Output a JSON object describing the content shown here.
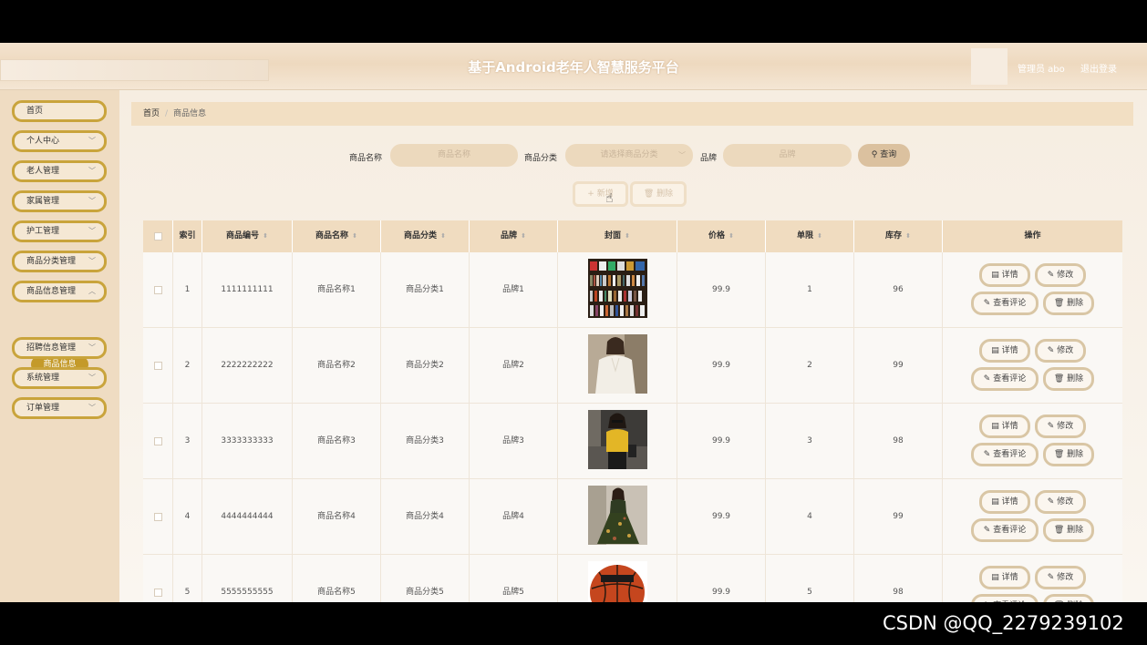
{
  "header": {
    "title": "基于Android老年人智慧服务平台",
    "user": "管理员 abo",
    "logout": "退出登录"
  },
  "sidebar": {
    "items": [
      {
        "label": "首页",
        "chevron": false
      },
      {
        "label": "个人中心",
        "chevron": true
      },
      {
        "label": "老人管理",
        "chevron": true
      },
      {
        "label": "家属管理",
        "chevron": true
      },
      {
        "label": "护工管理",
        "chevron": true
      },
      {
        "label": "商品分类管理",
        "chevron": true
      },
      {
        "label": "商品信息管理",
        "chevron": true
      },
      {
        "label": "招聘信息管理",
        "chevron": true
      },
      {
        "label": "系统管理",
        "chevron": true
      },
      {
        "label": "订单管理",
        "chevron": true
      }
    ],
    "submenu_active": "商品信息"
  },
  "breadcrumb": {
    "home": "首页",
    "separator": "/",
    "current": "商品信息"
  },
  "search": {
    "name_label": "商品名称",
    "name_placeholder": "商品名称",
    "category_label": "商品分类",
    "category_placeholder": "请选择商品分类",
    "brand_label": "品牌",
    "brand_placeholder": "品牌",
    "search_button": "查询"
  },
  "actions": {
    "add": "新增",
    "delete": "删除"
  },
  "table": {
    "columns": [
      "索引",
      "商品编号",
      "商品名称",
      "商品分类",
      "品牌",
      "封面",
      "价格",
      "单限",
      "库存",
      "操作"
    ],
    "rows": [
      {
        "index": "1",
        "code": "1111111111",
        "name": "商品名称1",
        "category": "商品分类1",
        "brand": "品牌1",
        "cover": "bookshelf",
        "price": "99.9",
        "limit": "1",
        "stock": "96"
      },
      {
        "index": "2",
        "code": "2222222222",
        "name": "商品名称2",
        "category": "商品分类2",
        "brand": "品牌2",
        "cover": "white-blouse",
        "price": "99.9",
        "limit": "2",
        "stock": "99"
      },
      {
        "index": "3",
        "code": "3333333333",
        "name": "商品名称3",
        "category": "商品分类3",
        "brand": "品牌3",
        "cover": "yellow-top",
        "price": "99.9",
        "limit": "3",
        "stock": "98"
      },
      {
        "index": "4",
        "code": "4444444444",
        "name": "商品名称4",
        "category": "商品分类4",
        "brand": "品牌4",
        "cover": "floral-dress",
        "price": "99.9",
        "limit": "4",
        "stock": "99"
      },
      {
        "index": "5",
        "code": "5555555555",
        "name": "商品名称5",
        "category": "商品分类5",
        "brand": "品牌5",
        "cover": "basketball",
        "price": "99.9",
        "limit": "5",
        "stock": "98"
      }
    ],
    "row_actions": {
      "detail": "详情",
      "edit": "修改",
      "comments": "查看评论",
      "delete": "删除"
    }
  },
  "watermark": "CSDN @QQ_2279239102",
  "colors": {
    "accent": "#c49a2a",
    "header_bg": "#f0dcc0",
    "button_border": "#d9c6a5"
  }
}
